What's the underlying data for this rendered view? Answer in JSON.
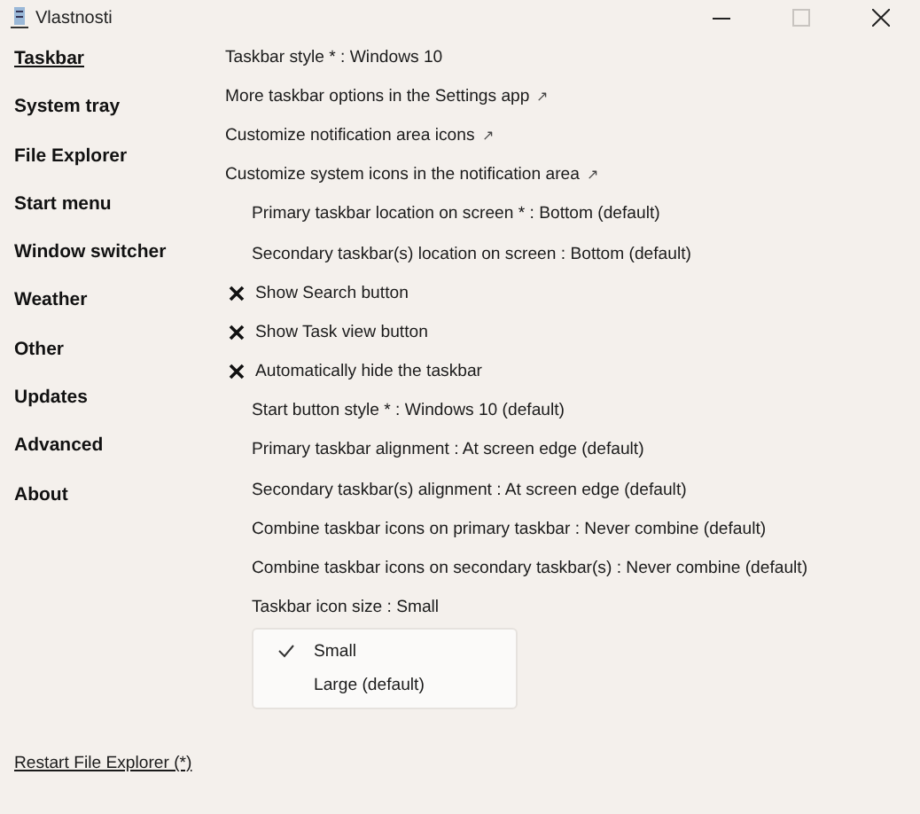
{
  "window": {
    "title": "Vlastnosti",
    "maximize_disabled": true
  },
  "sidebar": {
    "items": [
      {
        "label": "Taskbar",
        "selected": true
      },
      {
        "label": "System tray",
        "selected": false
      },
      {
        "label": "File Explorer",
        "selected": false
      },
      {
        "label": "Start menu",
        "selected": false
      },
      {
        "label": "Window switcher",
        "selected": false
      },
      {
        "label": "Weather",
        "selected": false
      },
      {
        "label": "Other",
        "selected": false
      },
      {
        "label": "Updates",
        "selected": false
      },
      {
        "label": "Advanced",
        "selected": false
      },
      {
        "label": "About",
        "selected": false
      }
    ],
    "footer_link": "Restart File Explorer (*)"
  },
  "settings": [
    {
      "kind": "text",
      "label": "Taskbar style * : Windows 10"
    },
    {
      "kind": "link",
      "label": "More taskbar options in the Settings app",
      "arrow": "↗"
    },
    {
      "kind": "link",
      "label": "Customize notification area icons",
      "arrow": "↗"
    },
    {
      "kind": "link",
      "label": "Customize system icons in the notification area",
      "arrow": "↗"
    },
    {
      "kind": "option",
      "label": "Primary taskbar location on screen * : Bottom (default)"
    },
    {
      "kind": "option",
      "label": "Secondary taskbar(s) location on screen : Bottom (default)"
    },
    {
      "kind": "toggle",
      "label": "Show Search button",
      "checked": false
    },
    {
      "kind": "toggle",
      "label": "Show Task view button",
      "checked": false
    },
    {
      "kind": "toggle",
      "label": "Automatically hide the taskbar",
      "checked": false
    },
    {
      "kind": "option",
      "label": "Start button style * : Windows 10 (default)"
    },
    {
      "kind": "option",
      "label": "Primary taskbar alignment : At screen edge (default)"
    },
    {
      "kind": "option",
      "label": "Secondary taskbar(s) alignment : At screen edge (default)"
    },
    {
      "kind": "option",
      "label": "Combine taskbar icons on primary taskbar : Never combine (default)"
    },
    {
      "kind": "option",
      "label": "Combine taskbar icons on secondary taskbar(s) : Never combine (default)"
    },
    {
      "kind": "option",
      "label": "Taskbar icon size : Small"
    }
  ],
  "dropdown_menu": [
    {
      "label": "Small",
      "selected": true
    },
    {
      "label": "Large (default)",
      "selected": false
    }
  ]
}
